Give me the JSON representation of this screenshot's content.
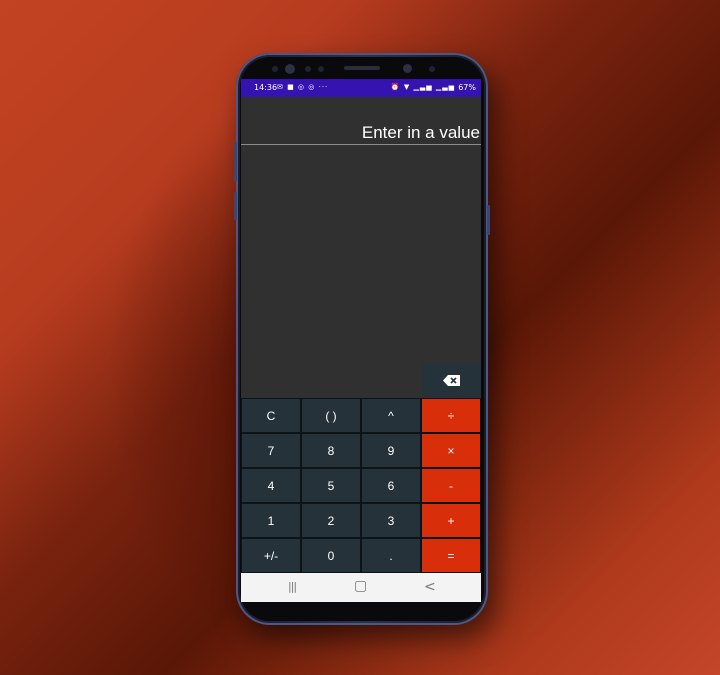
{
  "status_bar": {
    "time": "14:36",
    "left_icons": "✉ ■ ◎ ◎ ···",
    "right_icons": "⏰ ▼ ▁▃▅ ▁▃▅",
    "battery": "67%"
  },
  "display": {
    "value": "Enter in a value"
  },
  "keypad": {
    "rows": [
      [
        {
          "label": "C",
          "name": "clear-key",
          "op": false
        },
        {
          "label": "( )",
          "name": "parentheses-key",
          "op": false
        },
        {
          "label": "^",
          "name": "power-key",
          "op": false
        },
        {
          "label": "÷",
          "name": "divide-key",
          "op": true
        }
      ],
      [
        {
          "label": "7",
          "name": "digit-7-key",
          "op": false
        },
        {
          "label": "8",
          "name": "digit-8-key",
          "op": false
        },
        {
          "label": "9",
          "name": "digit-9-key",
          "op": false
        },
        {
          "label": "×",
          "name": "multiply-key",
          "op": true
        }
      ],
      [
        {
          "label": "4",
          "name": "digit-4-key",
          "op": false
        },
        {
          "label": "5",
          "name": "digit-5-key",
          "op": false
        },
        {
          "label": "6",
          "name": "digit-6-key",
          "op": false
        },
        {
          "label": "-",
          "name": "subtract-key",
          "op": true
        }
      ],
      [
        {
          "label": "1",
          "name": "digit-1-key",
          "op": false
        },
        {
          "label": "2",
          "name": "digit-2-key",
          "op": false
        },
        {
          "label": "3",
          "name": "digit-3-key",
          "op": false
        },
        {
          "label": "+",
          "name": "add-key",
          "op": true
        }
      ],
      [
        {
          "label": "+/-",
          "name": "negate-key",
          "op": false
        },
        {
          "label": "0",
          "name": "digit-0-key",
          "op": false
        },
        {
          "label": ".",
          "name": "decimal-key",
          "op": false
        },
        {
          "label": "=",
          "name": "equals-key",
          "op": true
        }
      ]
    ]
  },
  "nav_bar": {
    "recents": "|||",
    "home": "▢",
    "back": "<"
  },
  "colors": {
    "operator": "#d92e0a",
    "key": "#26323a",
    "status_bar": "#3413b0",
    "screen_bg": "#303030"
  },
  "icons": {
    "backspace": "backspace-icon"
  }
}
